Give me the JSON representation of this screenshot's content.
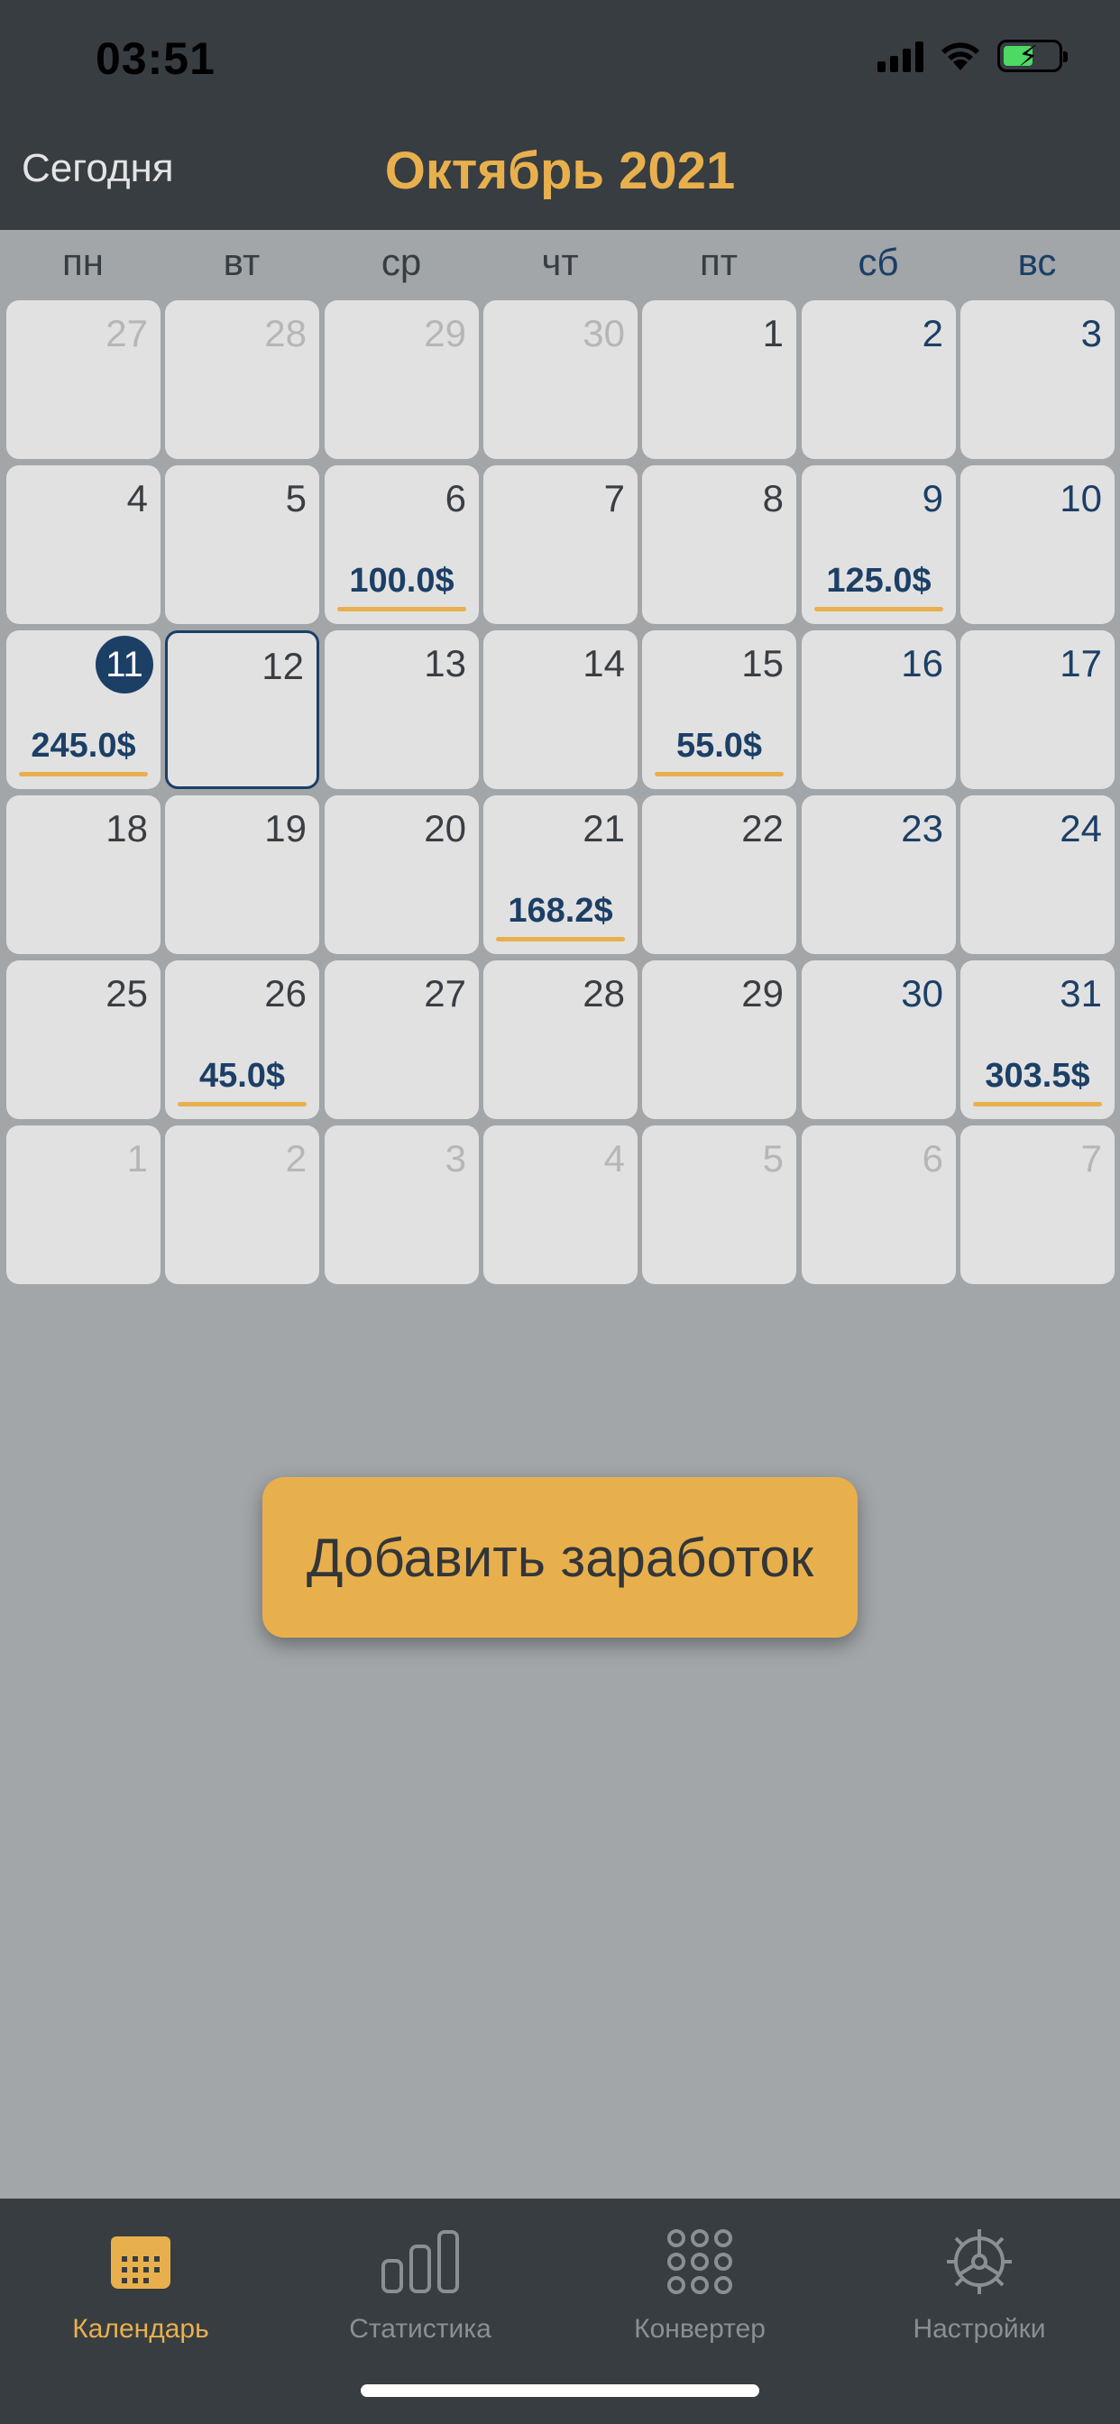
{
  "status_bar": {
    "time": "03:51"
  },
  "nav": {
    "today_label": "Сегодня",
    "month_title": "Октябрь 2021"
  },
  "weekdays": [
    "пн",
    "вт",
    "ср",
    "чт",
    "пт",
    "сб",
    "вс"
  ],
  "calendar": {
    "rows": [
      [
        {
          "day": "27",
          "other": true
        },
        {
          "day": "28",
          "other": true
        },
        {
          "day": "29",
          "other": true
        },
        {
          "day": "30",
          "other": true
        },
        {
          "day": "1"
        },
        {
          "day": "2"
        },
        {
          "day": "3"
        }
      ],
      [
        {
          "day": "4"
        },
        {
          "day": "5"
        },
        {
          "day": "6",
          "amount": "100.0$"
        },
        {
          "day": "7"
        },
        {
          "day": "8"
        },
        {
          "day": "9",
          "amount": "125.0$"
        },
        {
          "day": "10"
        }
      ],
      [
        {
          "day": "11",
          "today": true,
          "amount": "245.0$"
        },
        {
          "day": "12",
          "selected": true
        },
        {
          "day": "13"
        },
        {
          "day": "14"
        },
        {
          "day": "15",
          "amount": "55.0$"
        },
        {
          "day": "16"
        },
        {
          "day": "17"
        }
      ],
      [
        {
          "day": "18"
        },
        {
          "day": "19"
        },
        {
          "day": "20"
        },
        {
          "day": "21",
          "amount": "168.2$"
        },
        {
          "day": "22"
        },
        {
          "day": "23"
        },
        {
          "day": "24"
        }
      ],
      [
        {
          "day": "25"
        },
        {
          "day": "26",
          "amount": "45.0$"
        },
        {
          "day": "27"
        },
        {
          "day": "28"
        },
        {
          "day": "29"
        },
        {
          "day": "30"
        },
        {
          "day": "31",
          "amount": "303.5$"
        }
      ],
      [
        {
          "day": "1",
          "other": true
        },
        {
          "day": "2",
          "other": true
        },
        {
          "day": "3",
          "other": true
        },
        {
          "day": "4",
          "other": true
        },
        {
          "day": "5",
          "other": true
        },
        {
          "day": "6",
          "other": true
        },
        {
          "day": "7",
          "other": true
        }
      ]
    ]
  },
  "add_button": {
    "label": "Добавить заработок"
  },
  "tabs": [
    {
      "label": "Календарь",
      "icon": "calendar-icon",
      "active": true
    },
    {
      "label": "Статистика",
      "icon": "bar-chart-icon",
      "active": false
    },
    {
      "label": "Конвертер",
      "icon": "grid-dots-icon",
      "active": false
    },
    {
      "label": "Настройки",
      "icon": "gear-icon",
      "active": false
    }
  ],
  "colors": {
    "accent": "#e8b04d",
    "navy": "#1c3f66",
    "bar_background": "#383d41",
    "page_background": "#a2a6a8",
    "cell_background": "#e1e1e1"
  }
}
